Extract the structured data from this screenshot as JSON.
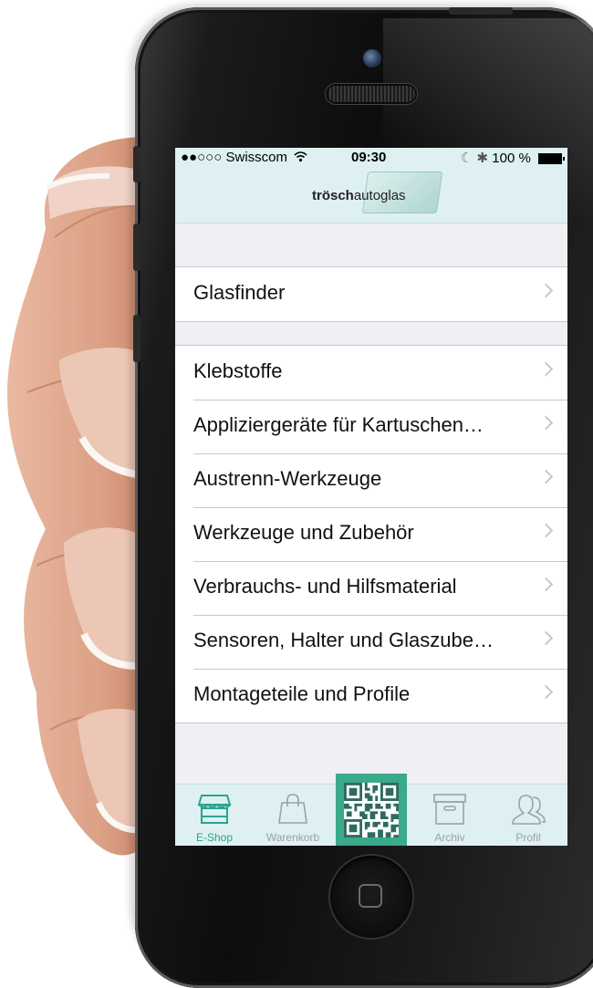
{
  "status_bar": {
    "signal": "●●○○○",
    "carrier": "Swisscom",
    "wifi_icon": "wifi-icon",
    "time": "09:30",
    "moon_icon": "☾",
    "bluetooth_icon": "✱",
    "battery": "100 %"
  },
  "header": {
    "logo_bold": "trösch",
    "logo_light": "autoglas"
  },
  "sections": [
    {
      "items": [
        {
          "label": "Glasfinder"
        }
      ]
    },
    {
      "items": [
        {
          "label": "Klebstoffe"
        },
        {
          "label": "Appliziergeräte für Kartuschen…"
        },
        {
          "label": "Austrenn-Werkzeuge"
        },
        {
          "label": "Werkzeuge und Zubehör"
        },
        {
          "label": "Verbrauchs- und Hilfsmaterial"
        },
        {
          "label": "Sensoren, Halter und Glaszube…"
        },
        {
          "label": "Montageteile und Profile"
        }
      ]
    }
  ],
  "tabbar": {
    "tabs": [
      {
        "label": "E-Shop",
        "icon": "shop-icon",
        "active": true
      },
      {
        "label": "Warenkorb",
        "icon": "shopping-bag-icon",
        "active": false
      },
      {
        "label": "",
        "icon": "qr-code-icon",
        "active": false
      },
      {
        "label": "Archiv",
        "icon": "archive-box-icon",
        "active": false
      },
      {
        "label": "Profil",
        "icon": "profile-icon",
        "active": false
      }
    ]
  },
  "colors": {
    "accent": "#2aa58f",
    "qr_tab": "#3aa98c",
    "header_bg": "#def0f2",
    "list_bg": "#efeff4"
  }
}
